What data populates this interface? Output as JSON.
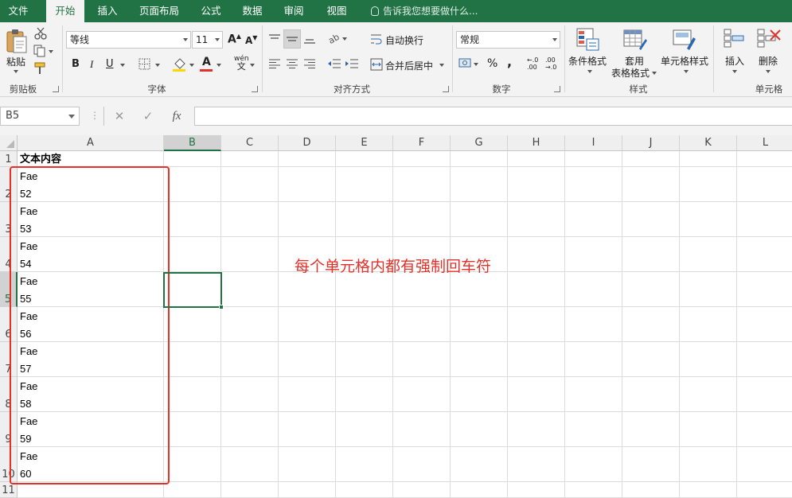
{
  "ribbon_tabs": [
    "文件",
    "开始",
    "插入",
    "页面布局",
    "公式",
    "数据",
    "审阅",
    "视图"
  ],
  "tell_me": "告诉我您想要做什么...",
  "clipboard": {
    "paste": "粘贴",
    "group": "剪贴板"
  },
  "font": {
    "name": "等线",
    "size": "11",
    "bold": "B",
    "italic": "I",
    "underline": "U",
    "group": "字体"
  },
  "alignment": {
    "wrap_text": "自动换行",
    "merge_center": "合并后居中",
    "group": "对齐方式"
  },
  "number": {
    "format": "常规",
    "percent": "%",
    "comma": ",",
    "group": "数字"
  },
  "styles": {
    "conditional": "条件格式",
    "table_line1": "套用",
    "table_line2": "表格格式",
    "cell_styles": "单元格样式",
    "group": "样式"
  },
  "cells": {
    "insert": "插入",
    "delete": "删除",
    "group": "单元格"
  },
  "formula_bar": {
    "name_box": "B5",
    "cancel": "✕",
    "enter": "✓",
    "fx": "fx",
    "content": ""
  },
  "columns": [
    "A",
    "B",
    "C",
    "D",
    "E",
    "F",
    "G",
    "H",
    "I",
    "J",
    "K",
    "L"
  ],
  "selected_column": "B",
  "rows": [
    "1",
    "2",
    "3",
    "4",
    "5",
    "6",
    "7",
    "8",
    "9",
    "10",
    "11"
  ],
  "selected_row": "5",
  "header_cell": "文本内容",
  "data_cells": [
    [
      "Fae",
      "52"
    ],
    [
      "Fae",
      "53"
    ],
    [
      "Fae",
      "54"
    ],
    [
      "Fae",
      "55"
    ],
    [
      "Fae",
      "56"
    ],
    [
      "Fae",
      "57"
    ],
    [
      "Fae",
      "58"
    ],
    [
      "Fae",
      "59"
    ],
    [
      "Fae",
      "60"
    ]
  ],
  "annotation": "每个单元格内都有强制回车符",
  "colors": {
    "excel_green": "#217346",
    "annotation_red": "#e3312a",
    "font_color_bar": "#e3312a",
    "fill_color_bar": "#ffd700"
  }
}
